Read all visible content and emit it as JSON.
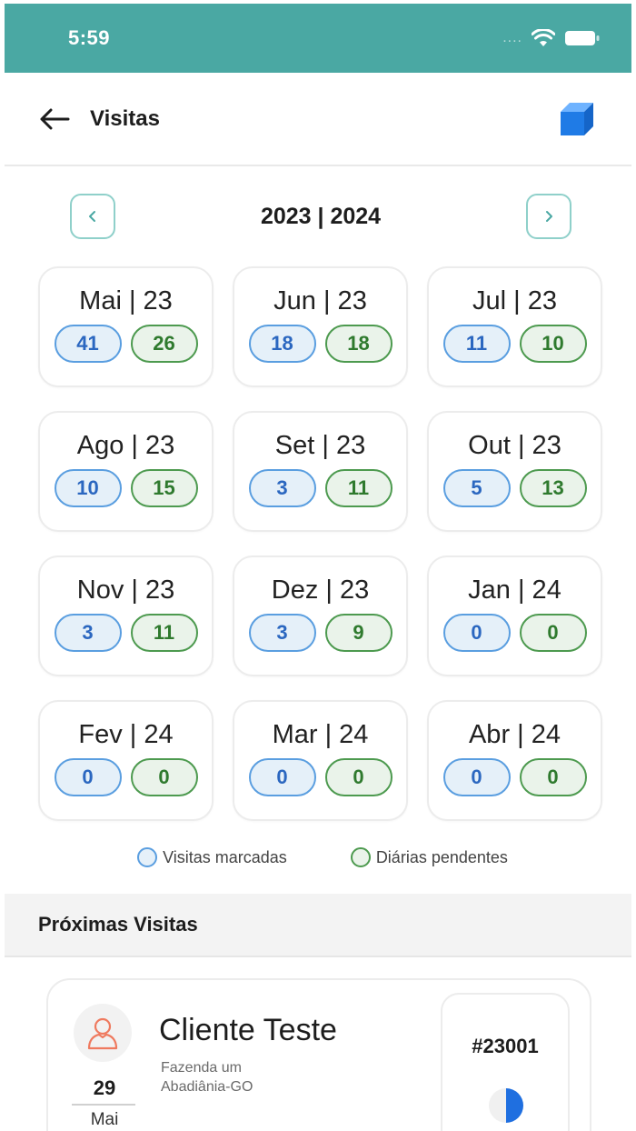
{
  "status": {
    "time": "5:59",
    "signal": "...."
  },
  "header": {
    "title": "Visitas",
    "back_icon": "arrow-left-icon",
    "action_icon": "cube-icon",
    "accent": "#1f7be6"
  },
  "year_nav": {
    "label": "2023 | 2024",
    "prev_icon": "chevron-left-icon",
    "next_icon": "chevron-right-icon"
  },
  "months": [
    {
      "label": "Mai | 23",
      "scheduled": "41",
      "pending": "26"
    },
    {
      "label": "Jun | 23",
      "scheduled": "18",
      "pending": "18"
    },
    {
      "label": "Jul | 23",
      "scheduled": "11",
      "pending": "10"
    },
    {
      "label": "Ago | 23",
      "scheduled": "10",
      "pending": "15"
    },
    {
      "label": "Set | 23",
      "scheduled": "3",
      "pending": "11"
    },
    {
      "label": "Out | 23",
      "scheduled": "5",
      "pending": "13"
    },
    {
      "label": "Nov | 23",
      "scheduled": "3",
      "pending": "11"
    },
    {
      "label": "Dez | 23",
      "scheduled": "3",
      "pending": "9"
    },
    {
      "label": "Jan | 24",
      "scheduled": "0",
      "pending": "0"
    },
    {
      "label": "Fev | 24",
      "scheduled": "0",
      "pending": "0"
    },
    {
      "label": "Mar | 24",
      "scheduled": "0",
      "pending": "0"
    },
    {
      "label": "Abr | 24",
      "scheduled": "0",
      "pending": "0"
    }
  ],
  "legend": {
    "scheduled": "Visitas marcadas",
    "pending": "Diárias pendentes"
  },
  "colors": {
    "teal": "#4aa8a3",
    "scheduled": "#5a9ee0",
    "pending": "#4d9a4f"
  },
  "upcoming": {
    "title": "Próximas Visitas",
    "visits": [
      {
        "day": "29",
        "month": "Mai",
        "client": "Cliente Teste",
        "address_line1": "Fazenda um",
        "address_line2": "Abadiânia-GO",
        "id": "#23001",
        "progress": 0.5,
        "avatar_icon": "user-icon"
      }
    ]
  }
}
